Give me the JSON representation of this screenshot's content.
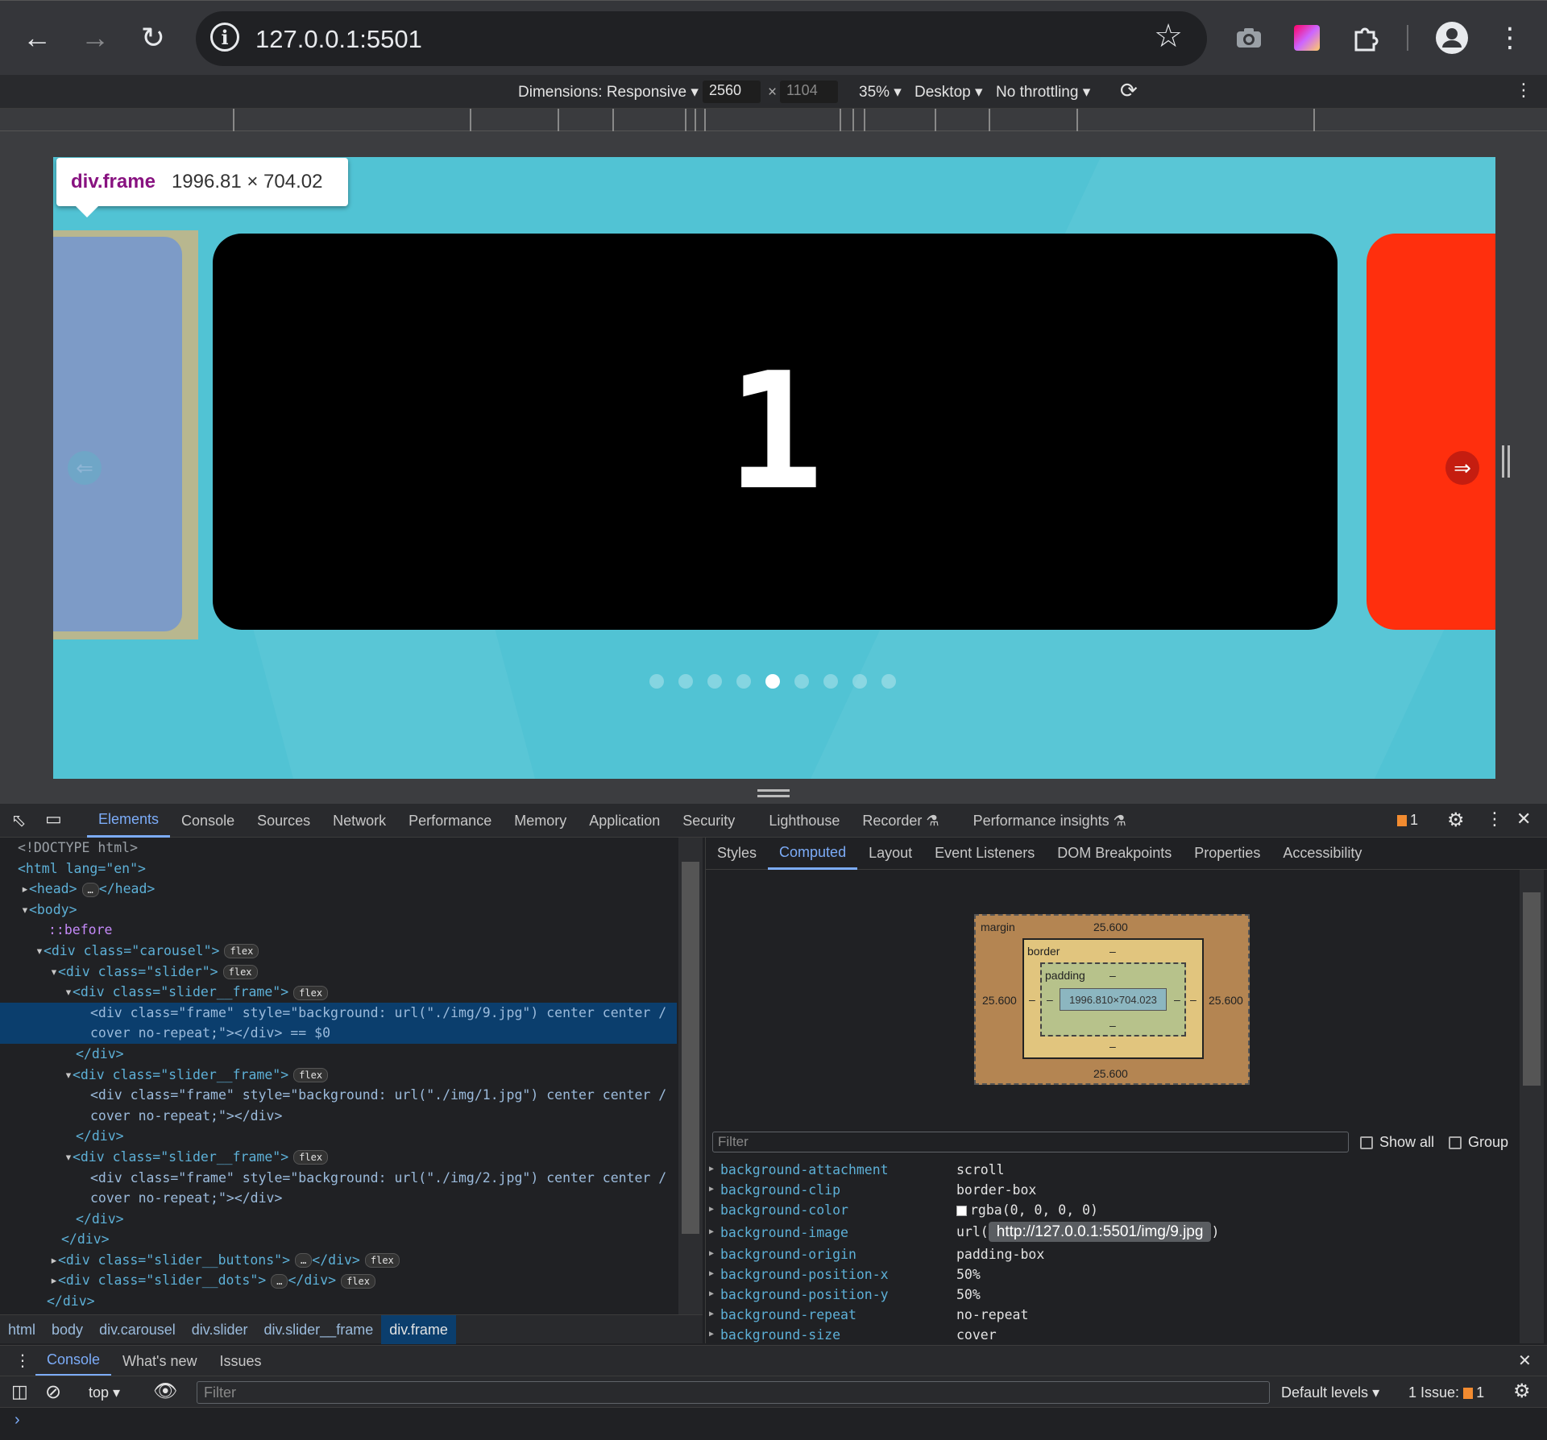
{
  "browser": {
    "url": "127.0.0.1:5501",
    "icons": [
      "back-arrow-icon",
      "forward-arrow-icon",
      "reload-icon",
      "info-icon",
      "star-icon",
      "camera-icon",
      "extension-icon",
      "puzzle-icon",
      "profile-icon",
      "kebab-menu-icon"
    ]
  },
  "device_toolbar": {
    "dimensions_label": "Dimensions: Responsive",
    "width": "2560",
    "height": "1104",
    "times": "×",
    "zoom": "35%",
    "device": "Desktop",
    "throttling": "No throttling"
  },
  "viewport": {
    "tooltip_tag": "div.frame",
    "tooltip_size": "1996.81 × 704.02",
    "slide_number": "1",
    "prev_arrow": "⇐",
    "next_arrow": "⇒",
    "dot_count": 9,
    "active_dot": 4,
    "colors": {
      "background": "#51c3d4",
      "left_frame": "#7d9bc7",
      "main_frame": "#000000",
      "right_frame": "#ff2f0d"
    }
  },
  "devtools": {
    "tabs": [
      "Elements",
      "Console",
      "Sources",
      "Network",
      "Performance",
      "Memory",
      "Application",
      "Security",
      "Lighthouse",
      "Recorder ⚗",
      "Performance insights ⚗"
    ],
    "issues_count": "1",
    "breadcrumb": [
      "html",
      "body",
      "div.carousel",
      "div.slider",
      "div.slider__frame",
      "div.frame"
    ],
    "side_tabs": [
      "Styles",
      "Computed",
      "Layout",
      "Event Listeners",
      "DOM Breakpoints",
      "Properties",
      "Accessibility"
    ],
    "box_model": {
      "margin_label": "margin",
      "margin_top": "25.600",
      "margin_bottom": "25.600",
      "margin_left": "25.600",
      "margin_right": "25.600",
      "border_label": "border",
      "border_val": "–",
      "padding_label": "padding",
      "padding_val": "–",
      "content": "1996.810×704.023"
    },
    "filter_placeholder": "Filter",
    "show_all": "Show all",
    "group": "Group",
    "computed": [
      {
        "name": "background-attachment",
        "value": "scroll"
      },
      {
        "name": "background-clip",
        "value": "border-box"
      },
      {
        "name": "background-color",
        "value": "rgba(0, 0, 0, 0)"
      },
      {
        "name": "background-image",
        "value": "http://127.0.0.1:5501/img/9.jpg"
      },
      {
        "name": "background-origin",
        "value": "padding-box"
      },
      {
        "name": "background-position-x",
        "value": "50%"
      },
      {
        "name": "background-position-y",
        "value": "50%"
      },
      {
        "name": "background-repeat",
        "value": "no-repeat"
      },
      {
        "name": "background-size",
        "value": "cover"
      }
    ],
    "url_prefix": "url(",
    "url_suffix": ")",
    "dom": {
      "doctype": "<!DOCTYPE html>",
      "html_open": "<html lang=\"en\">",
      "head": "<head>",
      "head_close": "</head>",
      "body": "<body>",
      "before": "::before",
      "carousel": "<div class=\"carousel\">",
      "slider": "<div class=\"slider\">",
      "slider_frame": "<div class=\"slider__frame\">",
      "frame9_a": "<div class=\"frame\" style=\"background: url(\"./img/9.jpg\") center center /",
      "frame9_b": "cover no-repeat;\"></div> == $0",
      "frame1_a": "<div class=\"frame\" style=\"background: url(\"./img/1.jpg\") center center /",
      "frame1_b": "cover no-repeat;\"></div>",
      "frame2_a": "<div class=\"frame\" style=\"background: url(\"./img/2.jpg\") center center /",
      "frame2_b": "cover no-repeat;\"></div>",
      "div_close": "</div>",
      "buttons": "<div class=\"slider__buttons\">",
      "dots": "<div class=\"slider__dots\">",
      "flex": "flex",
      "ellipsis": "…"
    }
  },
  "drawer": {
    "tabs": [
      "Console",
      "What's new",
      "Issues"
    ],
    "context": "top",
    "filter_placeholder": "Filter",
    "levels": "Default levels",
    "issue_label": "1 Issue:",
    "issue_count": "1",
    "prompt": "›"
  }
}
